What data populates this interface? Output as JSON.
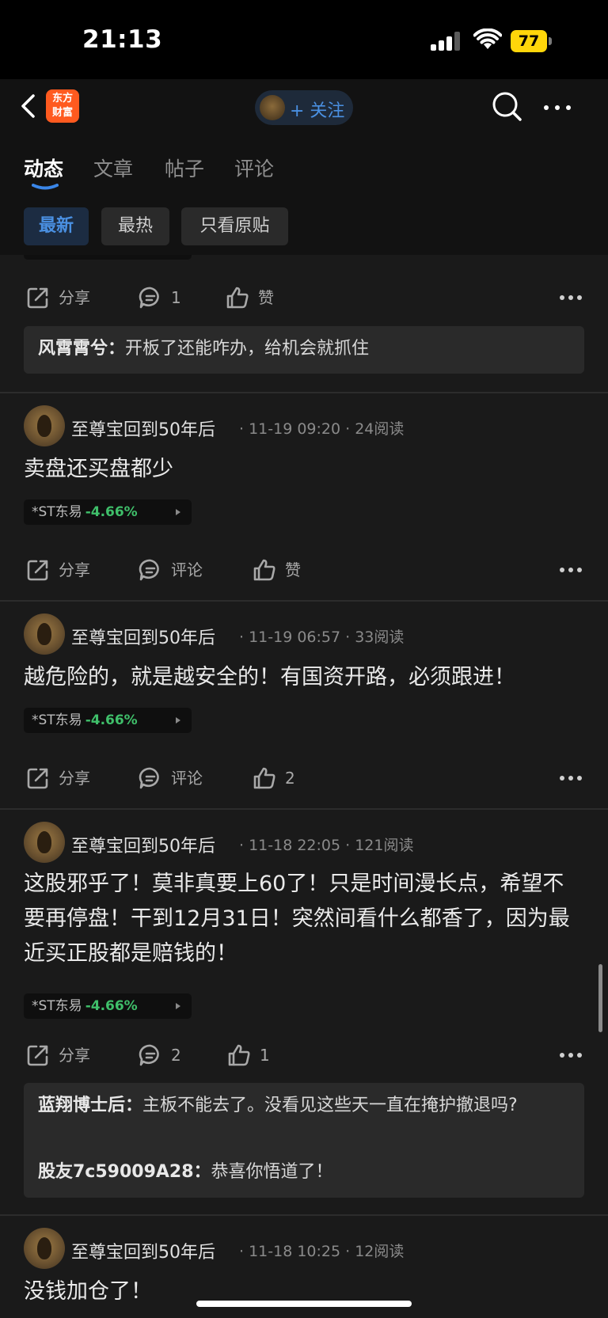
{
  "status_bar": {
    "time": "21:13",
    "battery": "77"
  },
  "nav": {
    "logo_line1": "东方",
    "logo_line2": "财富",
    "follow_label": "+ 关注"
  },
  "tabs": [
    {
      "label": "动态"
    },
    {
      "label": "文章"
    },
    {
      "label": "帖子"
    },
    {
      "label": "评论"
    }
  ],
  "filters": [
    {
      "label": "最新"
    },
    {
      "label": "最热"
    },
    {
      "label": "只看原贴"
    }
  ],
  "top_partial_post": {
    "actions": {
      "share": "分享",
      "comment": "1",
      "like": "赞"
    },
    "replies": [
      {
        "name": "风霄霄兮：",
        "text": "开板了还能咋办，给机会就抓住"
      }
    ]
  },
  "posts": [
    {
      "author": "至尊宝回到50年后",
      "meta": "· 11-19 09:20 · 24阅读",
      "content": "卖盘还买盘都少",
      "stock_name": "*ST东易",
      "stock_change": "-4.66%",
      "actions": {
        "share": "分享",
        "comment": "评论",
        "like": "赞"
      }
    },
    {
      "author": "至尊宝回到50年后",
      "meta": "· 11-19 06:57 · 33阅读",
      "content": "越危险的，就是越安全的！有国资开路，必须跟进！",
      "stock_name": "*ST东易",
      "stock_change": "-4.66%",
      "actions": {
        "share": "分享",
        "comment": "评论",
        "like": "2"
      }
    },
    {
      "author": "至尊宝回到50年后",
      "meta": "· 11-18 22:05 · 121阅读",
      "content": "这股邪乎了！莫非真要上60了！只是时间漫长点，希望不要再停盘！干到12月31日！突然间看什么都香了，因为最近买正股都是赔钱的！",
      "stock_name": "*ST东易",
      "stock_change": "-4.66%",
      "actions": {
        "share": "分享",
        "comment": "2",
        "like": "1"
      },
      "replies": [
        {
          "name": "蓝翔博士后：",
          "text": "主板不能去了。没看见这些天一直在掩护撤退吗?"
        },
        {
          "name": "股友7c59009A28：",
          "text": "恭喜你悟道了！"
        }
      ]
    },
    {
      "author": "至尊宝回到50年后",
      "meta": "· 11-18 10:25 · 12阅读",
      "content": "没钱加仓了！"
    }
  ]
}
